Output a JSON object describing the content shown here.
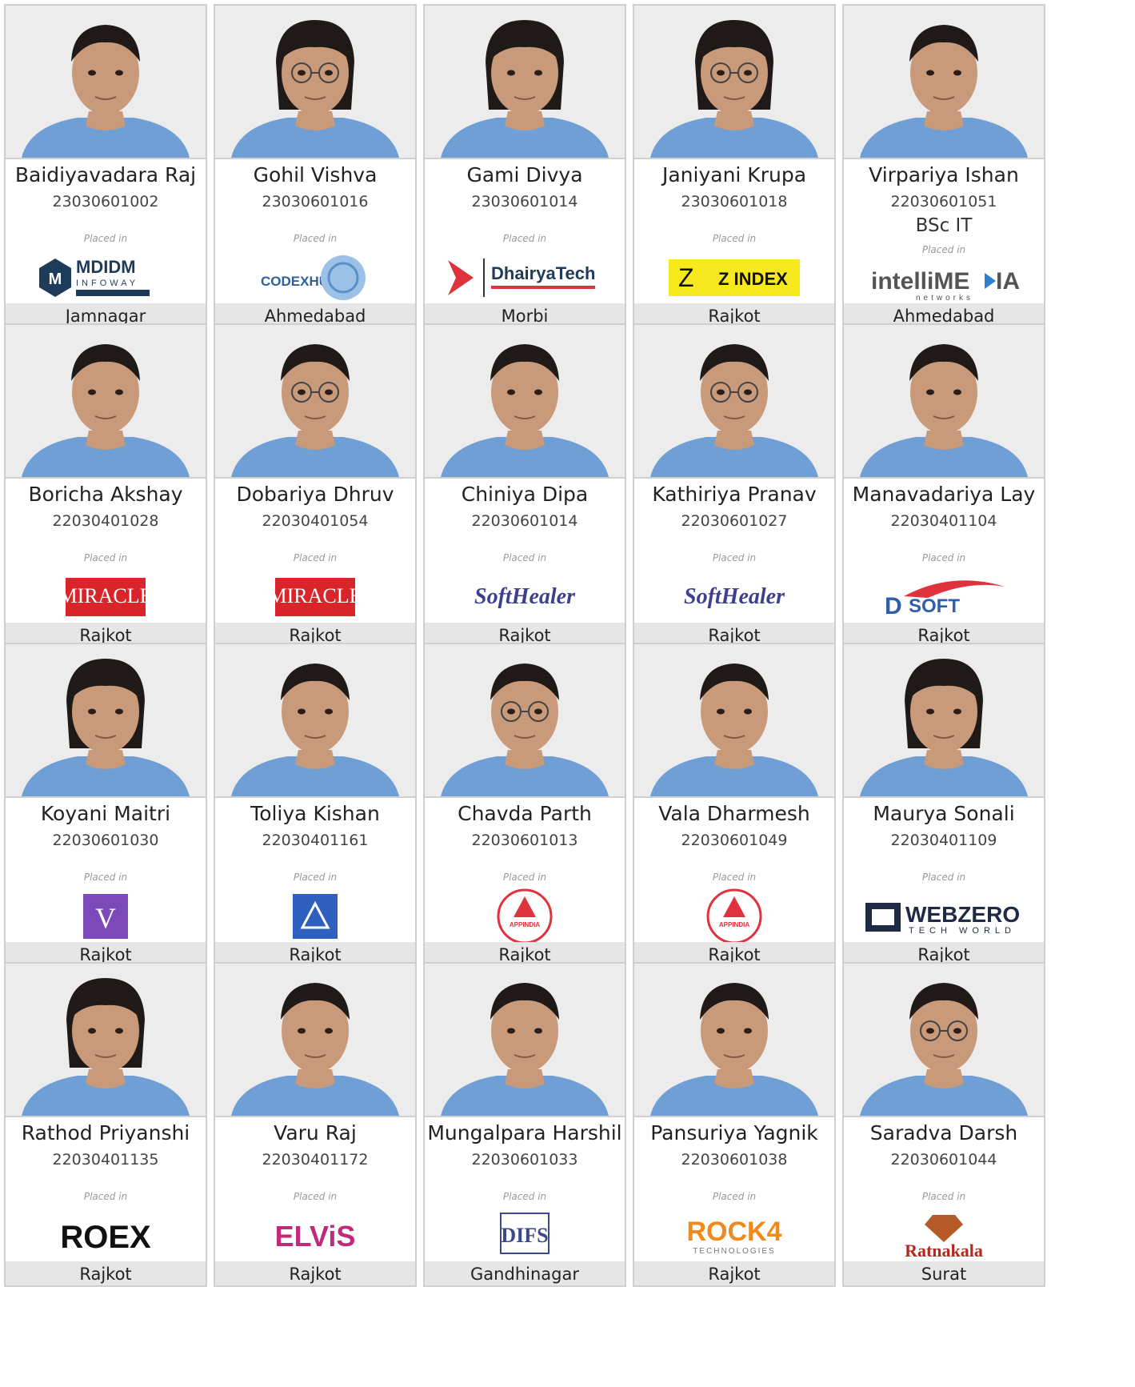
{
  "placed_label": "Placed in",
  "students": [
    {
      "name": "Baidiyavadara Raj",
      "enroll": "23030601002",
      "course": "",
      "company": "MDIDM INFOWAY",
      "logo": "mdidm",
      "city": "Jamnagar"
    },
    {
      "name": "Gohil Vishva",
      "enroll": "23030601016",
      "course": "",
      "company": "CODEXHUB TECH",
      "logo": "codexhub",
      "city": "Ahmedabad"
    },
    {
      "name": "Gami Divya",
      "enroll": "23030601014",
      "course": "",
      "company": "DhairyaTech",
      "logo": "dhairya",
      "city": "Morbi"
    },
    {
      "name": "Janiyani Krupa",
      "enroll": "23030601018",
      "course": "",
      "company": "Z INDEX",
      "logo": "zindex",
      "city": "Rajkot"
    },
    {
      "name": "Virpariya Ishan",
      "enroll": "22030601051",
      "course": "BSc IT",
      "company": "intelliMEDIA networks",
      "logo": "intellimedia",
      "city": "Ahmedabad"
    },
    {
      "name": "Boricha Akshay",
      "enroll": "22030401028",
      "course": "",
      "company": "MIRACLE",
      "logo": "miracle",
      "city": "Rajkot"
    },
    {
      "name": "Dobariya Dhruv",
      "enroll": "22030401054",
      "course": "",
      "company": "MIRACLE",
      "logo": "miracle",
      "city": "Rajkot"
    },
    {
      "name": "Chiniya Dipa",
      "enroll": "22030601014",
      "course": "",
      "company": "SoftHealer",
      "logo": "softhealer",
      "city": "Rajkot"
    },
    {
      "name": "Kathiriya Pranav",
      "enroll": "22030601027",
      "course": "",
      "company": "SoftHealer",
      "logo": "softhealer",
      "city": "Rajkot"
    },
    {
      "name": "Manavadariya Lay",
      "enroll": "22030401104",
      "course": "",
      "company": "D SOFT",
      "logo": "dsoft",
      "city": "Rajkot"
    },
    {
      "name": "Koyani Maitri",
      "enroll": "22030601030",
      "course": "",
      "company": "V",
      "logo": "vlogo",
      "city": "Rajkot"
    },
    {
      "name": "Toliya Kishan",
      "enroll": "22030401161",
      "course": "",
      "company": "Triangle",
      "logo": "trilogo",
      "city": "Rajkot"
    },
    {
      "name": "Chavda Parth",
      "enroll": "22030601013",
      "course": "",
      "company": "APPINDIA",
      "logo": "appindia",
      "city": "Rajkot"
    },
    {
      "name": "Vala Dharmesh",
      "enroll": "22030601049",
      "course": "",
      "company": "APPINDIA",
      "logo": "appindia",
      "city": "Rajkot"
    },
    {
      "name": "Maurya Sonali",
      "enroll": "22030401109",
      "course": "",
      "company": "WEBZERO TECH WORLD",
      "logo": "webzero",
      "city": "Rajkot"
    },
    {
      "name": "Rathod Priyanshi",
      "enroll": "22030401135",
      "course": "",
      "company": "ROEX",
      "logo": "roex",
      "city": "Rajkot"
    },
    {
      "name": "Varu Raj",
      "enroll": "22030401172",
      "course": "",
      "company": "ELVIS",
      "logo": "elvis",
      "city": "Rajkot"
    },
    {
      "name": "Mungalpara Harshil",
      "enroll": "22030601033",
      "course": "",
      "company": "DIFS",
      "logo": "difs",
      "city": "Gandhinagar"
    },
    {
      "name": "Pansuriya Yagnik",
      "enroll": "22030601038",
      "course": "",
      "company": "ROCK4 TECHNOLOGIES",
      "logo": "rock4",
      "city": "Rajkot"
    },
    {
      "name": "Saradva Darsh",
      "enroll": "22030601044",
      "course": "",
      "company": "Ratnakala",
      "logo": "ratnakala",
      "city": "Surat"
    }
  ],
  "colors": {
    "shirt": "#6f9fd4",
    "skin": "#c99a7a",
    "hair": "#1f1a18",
    "photo_bg": "#ececec",
    "city_bar": "#e6e6e6"
  }
}
